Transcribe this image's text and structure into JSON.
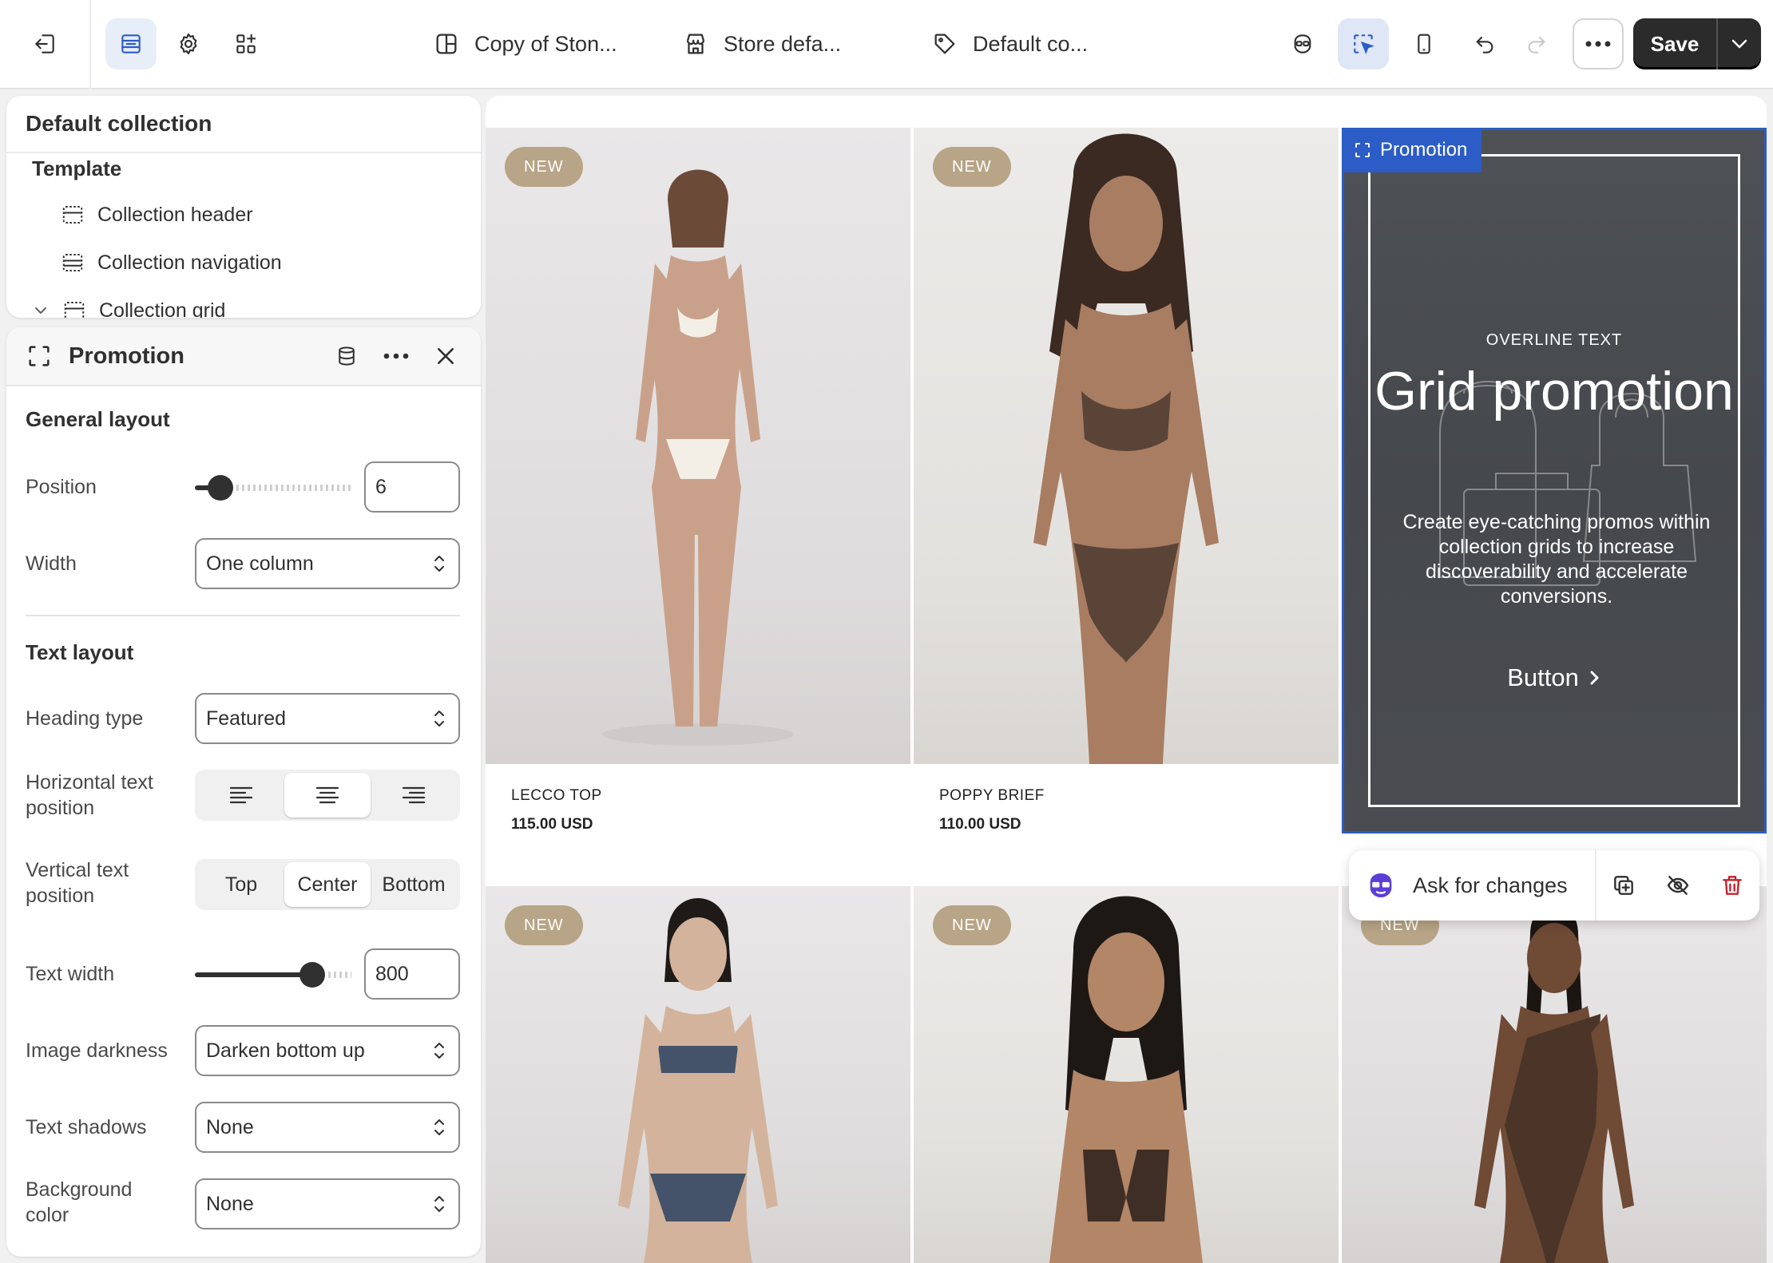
{
  "topbar": {
    "contexts": [
      {
        "label": "Copy of Ston...",
        "icon": "layout-icon"
      },
      {
        "label": "Store defa...",
        "icon": "store-icon"
      },
      {
        "label": "Default co...",
        "icon": "tag-icon"
      }
    ],
    "save_label": "Save"
  },
  "tree": {
    "title": "Default collection",
    "group": "Template",
    "items": [
      "Collection header",
      "Collection navigation",
      "Collection grid"
    ]
  },
  "settings": {
    "title": "Promotion",
    "general_layout": "General layout",
    "position_label": "Position",
    "position_value": "6",
    "position_fraction": 0.1,
    "width_label": "Width",
    "width_value": "One column",
    "text_layout": "Text layout",
    "heading_type_label": "Heading type",
    "heading_type_value": "Featured",
    "horizontal_label": "Horizontal text position",
    "horizontal_value": "center",
    "vertical_label": "Vertical text position",
    "vertical_options": [
      "Top",
      "Center",
      "Bottom"
    ],
    "vertical_value": "Center",
    "text_width_label": "Text width",
    "text_width_value": "800",
    "text_width_fraction": 0.8,
    "image_darkness_label": "Image darkness",
    "image_darkness_value": "Darken bottom up",
    "text_shadows_label": "Text shadows",
    "text_shadows_value": "None",
    "background_color_label": "Background color",
    "background_color_value": "None"
  },
  "products": [
    {
      "badge": "NEW",
      "name": "LECCO TOP",
      "price": "115.00 USD"
    },
    {
      "badge": "NEW",
      "name": "POPPY BRIEF",
      "price": "110.00 USD"
    },
    {
      "badge": "NEW"
    },
    {
      "badge": "NEW"
    },
    {
      "badge": "NEW"
    }
  ],
  "promotion": {
    "tag": "Promotion",
    "overline": "OVERLINE TEXT",
    "heading": "Grid promotion",
    "body": "Create eye-catching promos within collection grids to increase discoverability and accelerate conversions.",
    "button": "Button"
  },
  "ask": {
    "label": "Ask for changes"
  },
  "colors": {
    "accent": "#2c5cc5",
    "badge": "#b8a486",
    "save": "#2b2b2b"
  }
}
